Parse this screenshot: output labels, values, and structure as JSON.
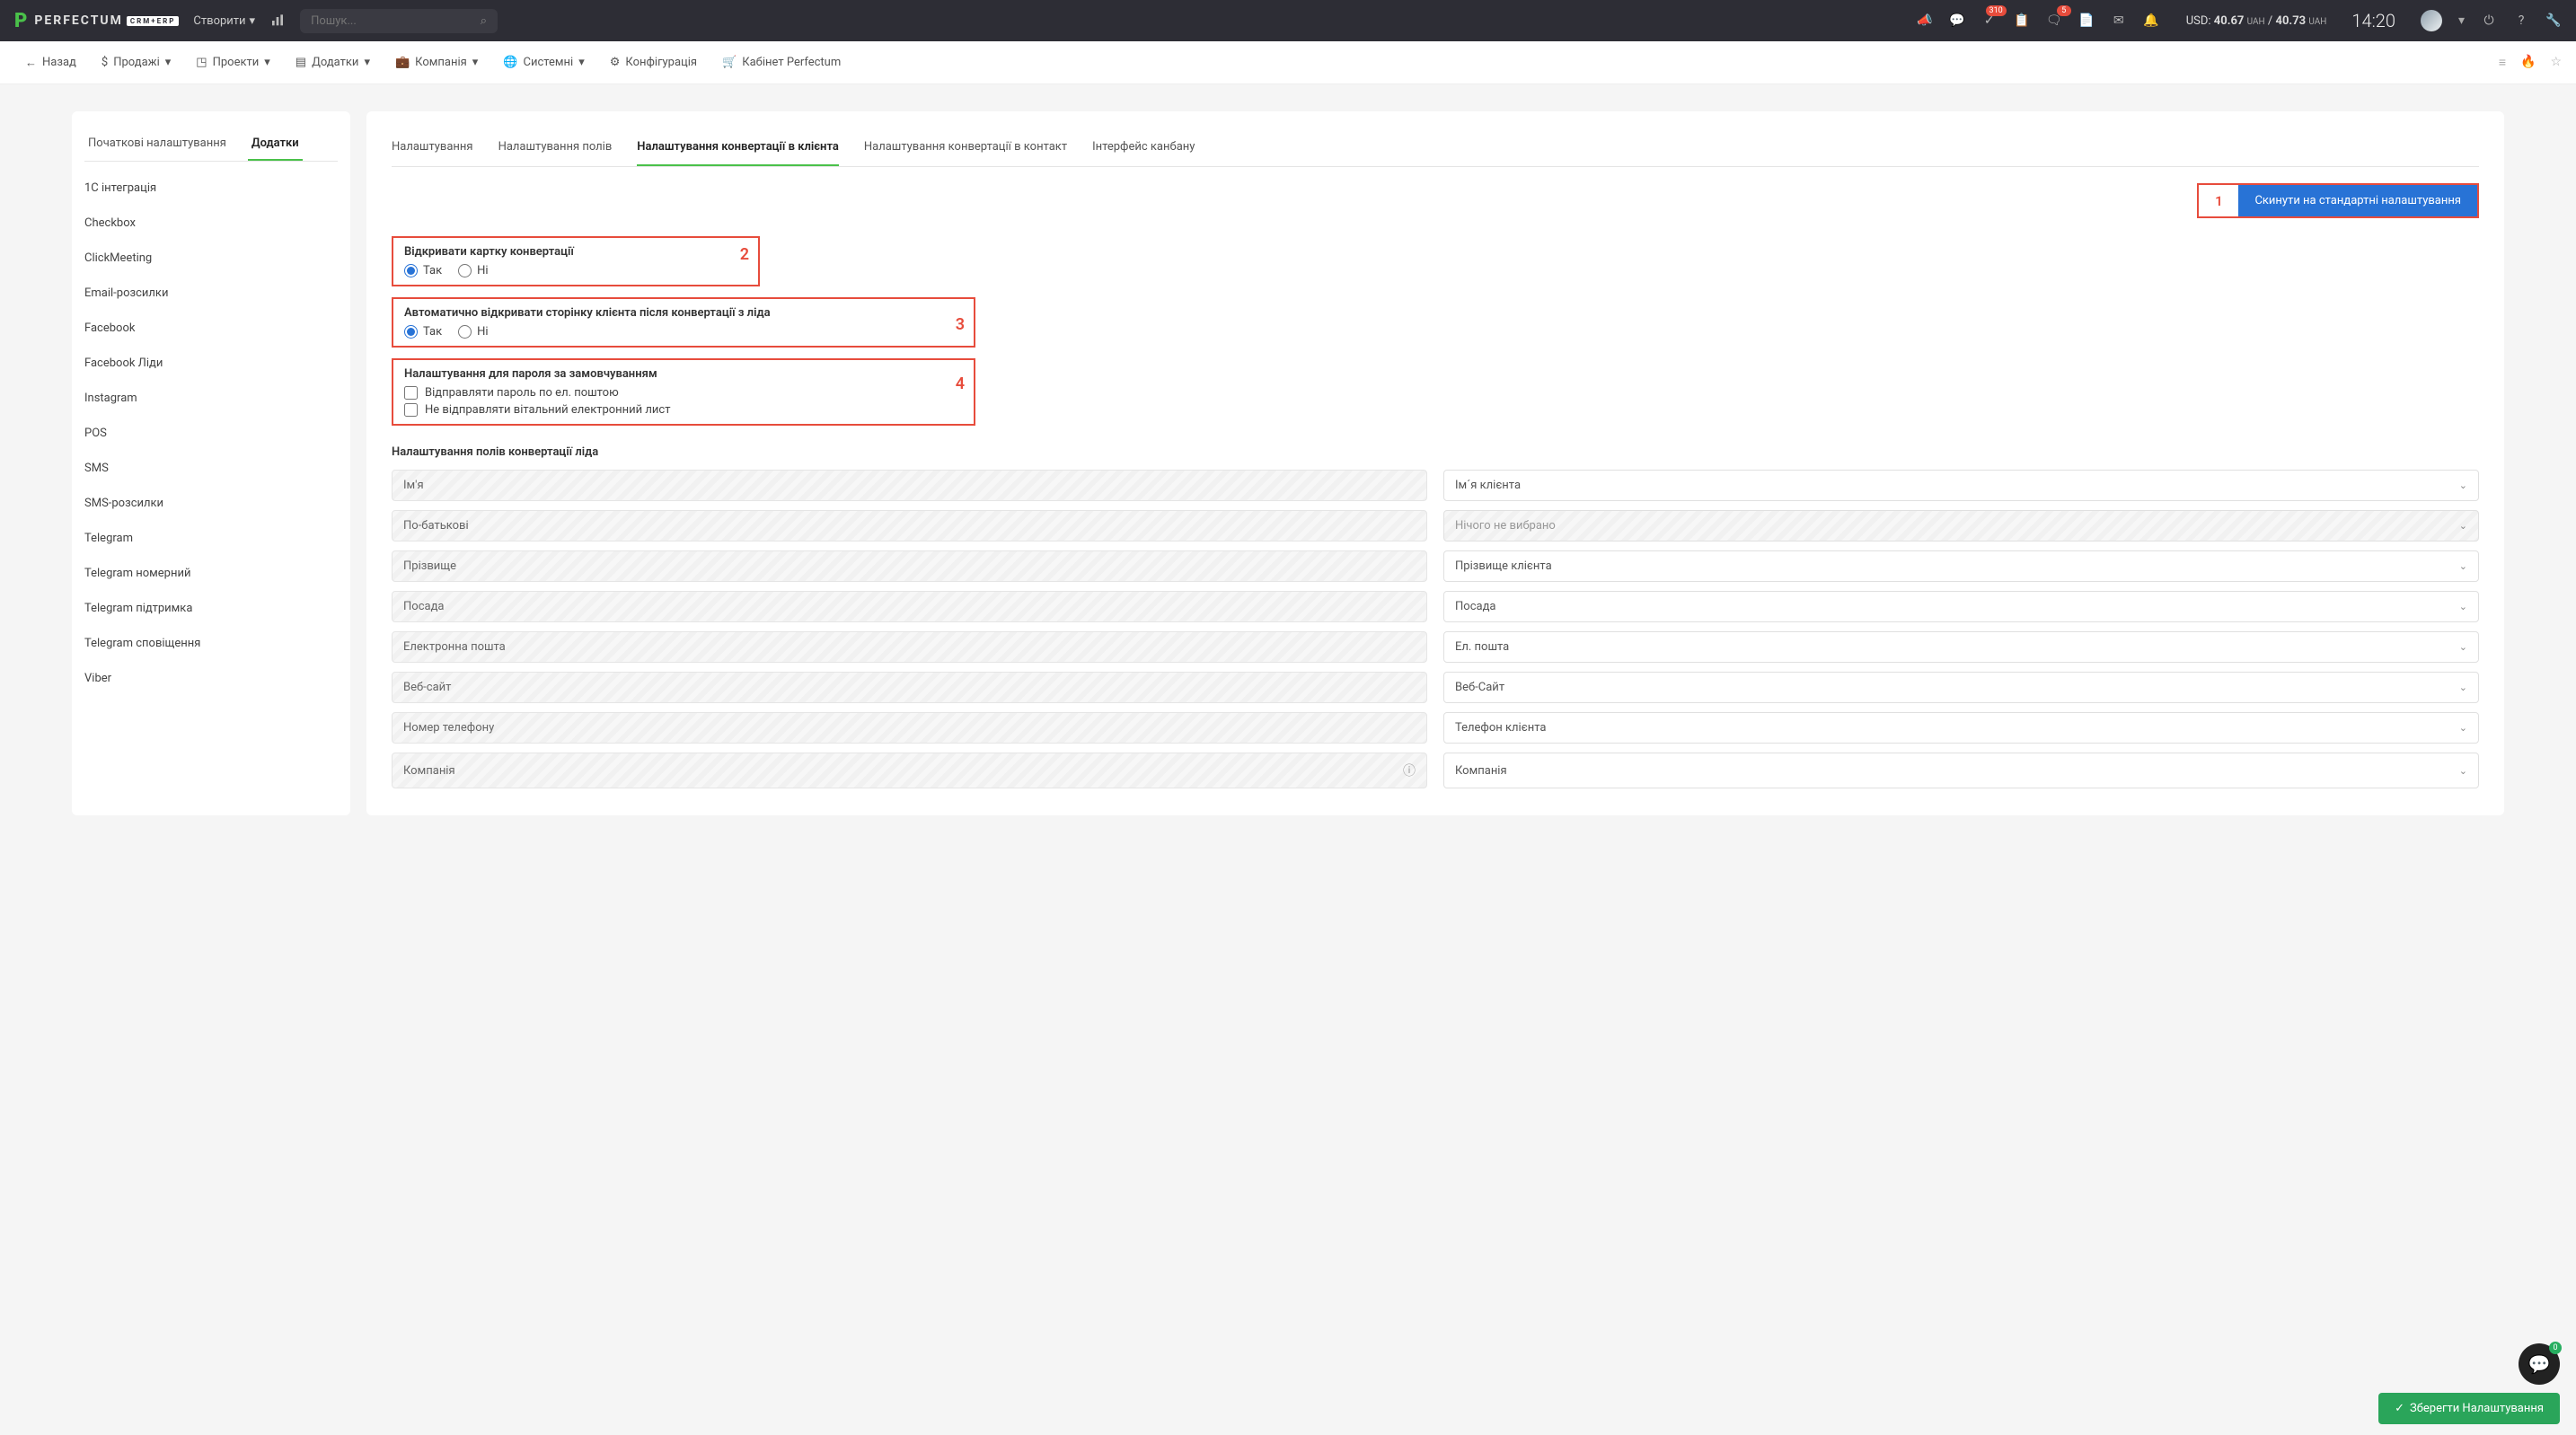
{
  "topbar": {
    "brand": "PERFECTUM",
    "brand_sub": "CRM+ERP",
    "create": "Створити",
    "search_ph": "Пошук...",
    "usd_label": "USD:",
    "rate_buy": "40.67",
    "rate_sell": "40.73",
    "unit": "UAH",
    "sep": " / ",
    "clock": "14:20",
    "badge_tasks": "310",
    "badge_chat": "5"
  },
  "nav": {
    "back": "Назад",
    "sales": "Продажі",
    "projects": "Проекти",
    "addons": "Додатки",
    "company": "Компанія",
    "system": "Системні",
    "config": "Конфігурація",
    "cabinet": "Кабінет Perfectum"
  },
  "sidebar": {
    "tabs": [
      "Початкові налаштування",
      "Додатки"
    ],
    "items": [
      "1С інтеграція",
      "Checkbox",
      "ClickMeeting",
      "Email-розсилки",
      "Facebook",
      "Facebook Ліди",
      "Instagram",
      "POS",
      "SMS",
      "SMS-розсилки",
      "Telegram",
      "Telegram номерний",
      "Telegram підтримка",
      "Telegram сповіщення",
      "Viber"
    ]
  },
  "main": {
    "tabs": [
      "Налаштування",
      "Налаштування полів",
      "Налаштування конвертації в клієнта",
      "Налаштування конвертації в контакт",
      "Інтерфейс канбану"
    ],
    "reset_btn": "Скинути на стандартні налаштування",
    "anno": {
      "1": "1",
      "2": "2",
      "3": "3",
      "4": "4"
    },
    "block2": {
      "title": "Відкривати картку конвертації",
      "yes": "Так",
      "no": "Ні"
    },
    "block3": {
      "title": "Автоматично відкривати сторінку клієнта після конвертації з ліда",
      "yes": "Так",
      "no": "Ні"
    },
    "block4": {
      "title": "Налаштування для пароля за замовчуванням",
      "cb1": "Відправляти пароль по ел. поштою",
      "cb2": "Не відправляти вітальний електронний лист"
    },
    "fields_title": "Налаштування полів конвертації ліда",
    "fields": [
      {
        "l": "Ім'я",
        "r": "Ім´я клієнта"
      },
      {
        "l": "По-батькові",
        "r": "Нічого не вибрано",
        "disabled": true
      },
      {
        "l": "Прізвище",
        "r": "Прізвище клієнта"
      },
      {
        "l": "Посада",
        "r": "Посада"
      },
      {
        "l": "Електронна пошта",
        "r": "Ел. пошта"
      },
      {
        "l": "Веб-сайт",
        "r": "Веб-Сайт"
      },
      {
        "l": "Номер телефону",
        "r": "Телефон клієнта"
      },
      {
        "l": "Компанія",
        "r": "Компанія",
        "info": true
      }
    ]
  },
  "save": "Зберегти Налаштування",
  "chat_count": "0"
}
